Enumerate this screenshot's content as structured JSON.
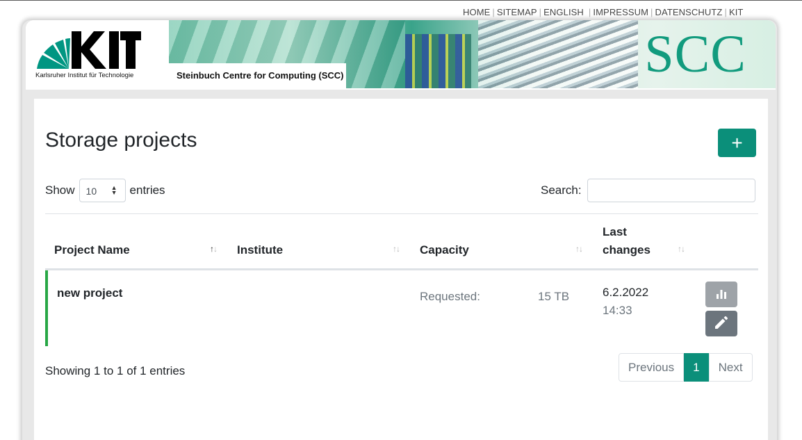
{
  "topnav": {
    "items": [
      "HOME",
      "SITEMAP",
      "ENGLISH",
      "IMPRESSUM",
      "DATENSCHUTZ",
      "KIT"
    ]
  },
  "header": {
    "logo_text": "KIT",
    "logo_subtitle": "Karlsruher Institut für Technologie",
    "banner_label": "Steinbuch Centre for Computing (SCC)",
    "banner_logo": "SCC"
  },
  "page": {
    "title": "Storage projects",
    "add_button_icon": "plus-icon",
    "add_button_symbol": "+"
  },
  "length": {
    "prefix": "Show",
    "value": "10",
    "suffix": "entries"
  },
  "search": {
    "label": "Search:",
    "value": "",
    "placeholder": ""
  },
  "table": {
    "columns": [
      "Project Name",
      "Institute",
      "Capacity",
      "Last",
      "changes"
    ],
    "rows": [
      {
        "name": "new project",
        "institute": "",
        "capacity_label": "Requested:",
        "capacity_value": "15 TB",
        "date": "6.2.2022",
        "time": "14:33"
      }
    ]
  },
  "footer": {
    "info": "Showing 1 to 1 of 1 entries",
    "pagination": {
      "previous": "Previous",
      "current": "1",
      "next": "Next"
    }
  },
  "colors": {
    "accent": "#0b8f7a",
    "row_status": "#28a745",
    "scc_green": "#129b7e"
  }
}
